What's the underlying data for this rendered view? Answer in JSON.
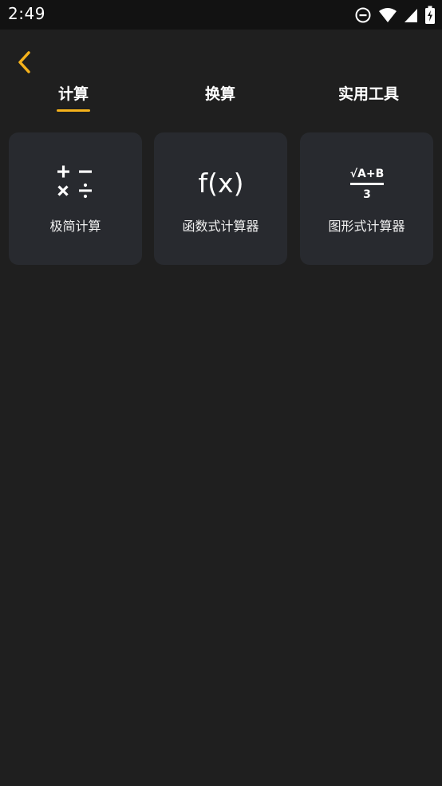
{
  "status_bar": {
    "time": "2:49",
    "icons": [
      "do-not-disturb-icon",
      "wifi-icon",
      "cellular-signal-icon",
      "battery-charging-icon"
    ]
  },
  "nav": {
    "back_icon": "chevron-left-icon",
    "accent_color": "#f5b21b"
  },
  "tabs": [
    {
      "label": "计算",
      "active": true
    },
    {
      "label": "换算",
      "active": false
    },
    {
      "label": "实用工具",
      "active": false
    }
  ],
  "cards": [
    {
      "label": "极简计算",
      "icon": "basic-operators-icon"
    },
    {
      "label": "函数式计算器",
      "icon": "function-fx-icon",
      "icon_text": "f(x)"
    },
    {
      "label": "图形式计算器",
      "icon": "sqrt-fraction-icon",
      "icon_text_top": "√A+B",
      "icon_text_bottom": "3"
    }
  ],
  "colors": {
    "background": "#1f1f1f",
    "status_bar": "#121212",
    "card": "#282a2f",
    "text": "#ffffff"
  }
}
